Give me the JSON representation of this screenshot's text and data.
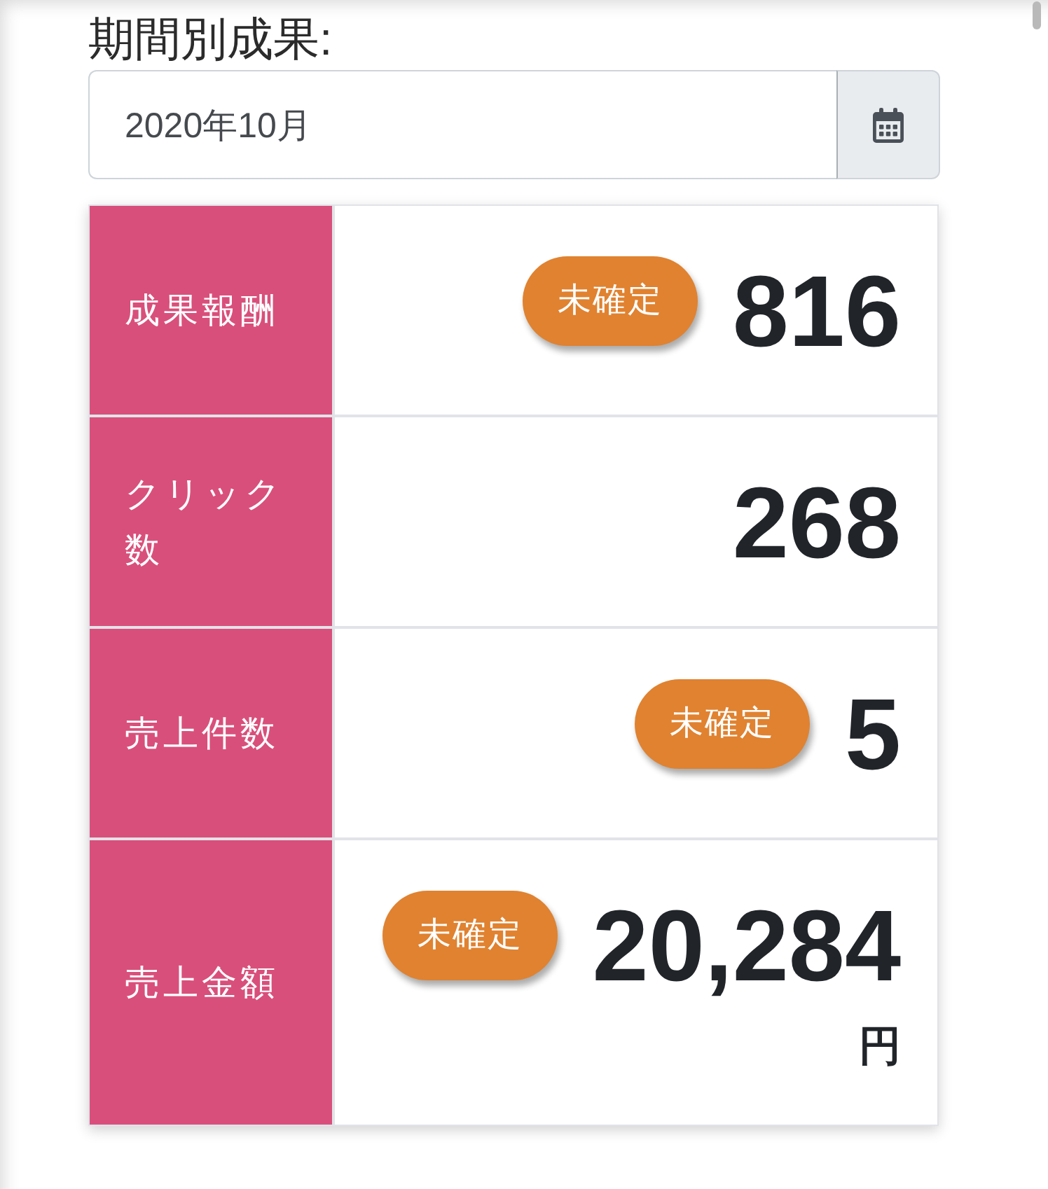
{
  "filter": {
    "label": "期間別成果:",
    "value": "2020年10月"
  },
  "stats": [
    {
      "label": "成果報酬",
      "badge": "未確定",
      "value": "816"
    },
    {
      "label": "クリック数",
      "value": "268"
    },
    {
      "label": "売上件数",
      "badge": "未確定",
      "value": "5"
    },
    {
      "label": "売上金額",
      "badge": "未確定",
      "value": "20,284",
      "unit": "円"
    }
  ]
}
